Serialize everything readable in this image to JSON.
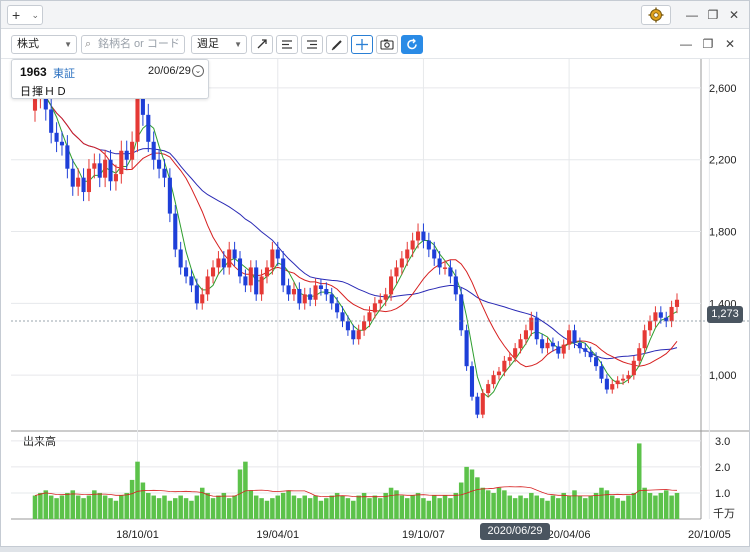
{
  "titlebar": {
    "add_label": "+",
    "gear": "gear-icon",
    "minimize": "—",
    "restore": "❐",
    "close": "✕"
  },
  "toolbar": {
    "asset_type": "株式",
    "search_placeholder": "銘柄名 or コード",
    "period": "週足",
    "tools": [
      "trendline-icon",
      "list-icon",
      "list-alt-icon",
      "pencil-icon",
      "crosshair-icon",
      "camera-icon",
      "refresh-icon"
    ]
  },
  "pane_controls": {
    "minimize": "—",
    "popout": "❐",
    "close": "✕"
  },
  "info_box": {
    "code": "1963",
    "exchange": "東証",
    "date": "20/06/29",
    "name": "日揮ＨＤ"
  },
  "price_axis": {
    "ticks": [
      "2,600",
      "2,200",
      "1,800",
      "1,400",
      "1,000"
    ],
    "current": "1,273"
  },
  "volume_axis": {
    "label": "出来高",
    "ticks": [
      "3.0",
      "2.0",
      "1.0"
    ],
    "unit": "千万"
  },
  "time_axis": {
    "ticks": [
      "18/10/01",
      "19/04/01",
      "19/10/07",
      "20/04/06",
      "20/10/05"
    ],
    "cursor_date": "2020/06/29"
  },
  "colors": {
    "up": "#e53935",
    "down": "#1e3fd8",
    "ma_short": "#2e9e2e",
    "ma_mid": "#d62020",
    "ma_long": "#2a2ab5",
    "volume": "#5cc24a"
  },
  "chart_data": {
    "type": "candlestick",
    "interval": "weekly",
    "ylim": [
      700,
      2750
    ],
    "volume_ylim": [
      0,
      3.3
    ],
    "price_ticks": [
      2600,
      2200,
      1800,
      1400,
      1000
    ],
    "volume_ticks": [
      3.0,
      2.0,
      1.0
    ],
    "x_ticks": [
      "18/10/01",
      "19/04/01",
      "19/10/07",
      "20/04/06",
      "20/10/05"
    ],
    "x_tick_index": [
      19,
      45,
      72,
      99,
      125
    ],
    "closes": [
      2550,
      2620,
      2480,
      2350,
      2300,
      2280,
      2150,
      2050,
      2100,
      2020,
      2150,
      2180,
      2100,
      2200,
      2080,
      2120,
      2250,
      2200,
      2300,
      2550,
      2450,
      2300,
      2200,
      2150,
      2100,
      1900,
      1700,
      1600,
      1550,
      1500,
      1400,
      1450,
      1550,
      1600,
      1650,
      1600,
      1700,
      1650,
      1550,
      1500,
      1600,
      1450,
      1550,
      1600,
      1700,
      1650,
      1500,
      1450,
      1480,
      1400,
      1450,
      1420,
      1500,
      1480,
      1450,
      1400,
      1350,
      1300,
      1250,
      1200,
      1250,
      1300,
      1350,
      1400,
      1420,
      1450,
      1550,
      1600,
      1650,
      1700,
      1750,
      1800,
      1750,
      1700,
      1650,
      1600,
      1600,
      1550,
      1450,
      1250,
      1050,
      880,
      780,
      900,
      950,
      1000,
      1020,
      1080,
      1100,
      1150,
      1200,
      1250,
      1320,
      1200,
      1150,
      1180,
      1160,
      1120,
      1170,
      1250,
      1180,
      1150,
      1130,
      1100,
      1050,
      980,
      920,
      950,
      970,
      980,
      1000,
      1080,
      1150,
      1250,
      1300,
      1350,
      1320,
      1300,
      1380,
      1420
    ],
    "volumes": [
      0.9,
      1.0,
      1.1,
      0.9,
      0.8,
      0.9,
      1.0,
      1.1,
      0.9,
      0.8,
      0.9,
      1.1,
      1.0,
      0.9,
      0.8,
      0.7,
      0.9,
      1.0,
      1.5,
      2.2,
      1.4,
      1.0,
      0.9,
      0.8,
      0.9,
      0.7,
      0.8,
      0.9,
      0.8,
      0.7,
      0.9,
      1.2,
      1.0,
      0.8,
      0.9,
      1.0,
      0.8,
      0.9,
      1.9,
      2.2,
      1.1,
      0.9,
      0.8,
      0.7,
      0.8,
      0.9,
      1.0,
      1.1,
      0.9,
      0.8,
      0.9,
      0.8,
      0.9,
      0.7,
      0.8,
      0.9,
      1.0,
      0.9,
      0.8,
      0.7,
      0.9,
      1.0,
      0.8,
      0.9,
      0.8,
      1.0,
      1.2,
      1.1,
      0.9,
      0.8,
      0.9,
      1.0,
      0.8,
      0.7,
      0.9,
      0.8,
      0.9,
      0.8,
      1.0,
      1.4,
      2.0,
      1.9,
      1.6,
      1.2,
      1.1,
      1.0,
      1.2,
      1.1,
      0.9,
      0.8,
      0.9,
      0.8,
      1.0,
      0.9,
      0.8,
      0.7,
      0.9,
      0.8,
      1.0,
      0.9,
      1.1,
      0.9,
      0.8,
      0.9,
      1.0,
      1.2,
      1.1,
      0.9,
      0.8,
      0.7,
      0.9,
      1.0,
      2.9,
      1.2,
      1.0,
      0.9,
      1.0,
      1.1,
      0.9,
      1.0
    ]
  }
}
